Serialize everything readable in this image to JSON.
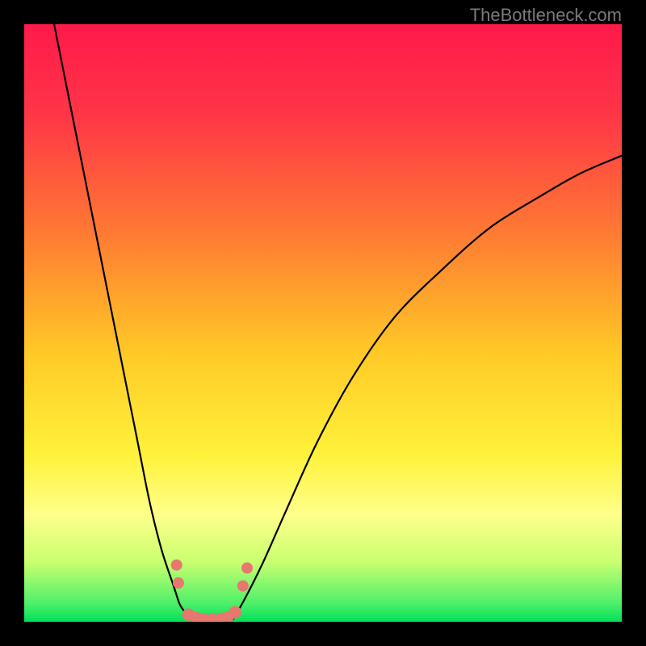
{
  "watermark": "TheBottleneck.com",
  "chart_data": {
    "type": "line",
    "title": "",
    "xlabel": "",
    "ylabel": "",
    "xlim": [
      0,
      100
    ],
    "ylim": [
      0,
      100
    ],
    "grid": false,
    "legend": false,
    "background_gradient": {
      "stops": [
        {
          "offset": 0.0,
          "color": "#ff1a4b"
        },
        {
          "offset": 0.15,
          "color": "#ff3547"
        },
        {
          "offset": 0.35,
          "color": "#ff7a33"
        },
        {
          "offset": 0.55,
          "color": "#ffc926"
        },
        {
          "offset": 0.72,
          "color": "#fff23a"
        },
        {
          "offset": 0.82,
          "color": "#ffff8a"
        },
        {
          "offset": 0.9,
          "color": "#c9ff70"
        },
        {
          "offset": 0.97,
          "color": "#4cf06a"
        },
        {
          "offset": 1.0,
          "color": "#00e05a"
        }
      ]
    },
    "series": [
      {
        "name": "left-arm",
        "color": "#000000",
        "x": [
          5,
          7,
          9,
          11,
          13,
          15,
          17,
          19,
          21,
          23,
          25,
          26,
          27,
          28
        ],
        "y": [
          100,
          90,
          80,
          70,
          60,
          50,
          40,
          30,
          20,
          12,
          6,
          3,
          1.5,
          0.5
        ]
      },
      {
        "name": "right-arm",
        "color": "#000000",
        "x": [
          35,
          37,
          40,
          44,
          49,
          55,
          62,
          70,
          78,
          86,
          93,
          100
        ],
        "y": [
          0.5,
          4,
          10,
          19,
          30,
          41,
          51,
          59,
          66,
          71,
          75,
          78
        ]
      },
      {
        "name": "floor",
        "color": "#000000",
        "x": [
          28,
          30,
          32,
          34,
          35
        ],
        "y": [
          0.5,
          0,
          0,
          0,
          0.5
        ]
      }
    ],
    "markers": {
      "name": "floor-dots",
      "color": "#e7776f",
      "x": [
        25.5,
        25.8,
        27.5,
        28.8,
        30.0,
        31.5,
        33.0,
        34.2,
        35.3,
        36.6,
        37.3
      ],
      "y": [
        9.5,
        6.5,
        1.2,
        0.7,
        0.5,
        0.5,
        0.6,
        0.9,
        1.6,
        6.0,
        9.0
      ],
      "r": [
        1.0,
        1.0,
        1.1,
        1.0,
        1.0,
        1.0,
        1.0,
        1.0,
        1.1,
        1.0,
        1.0
      ]
    }
  }
}
